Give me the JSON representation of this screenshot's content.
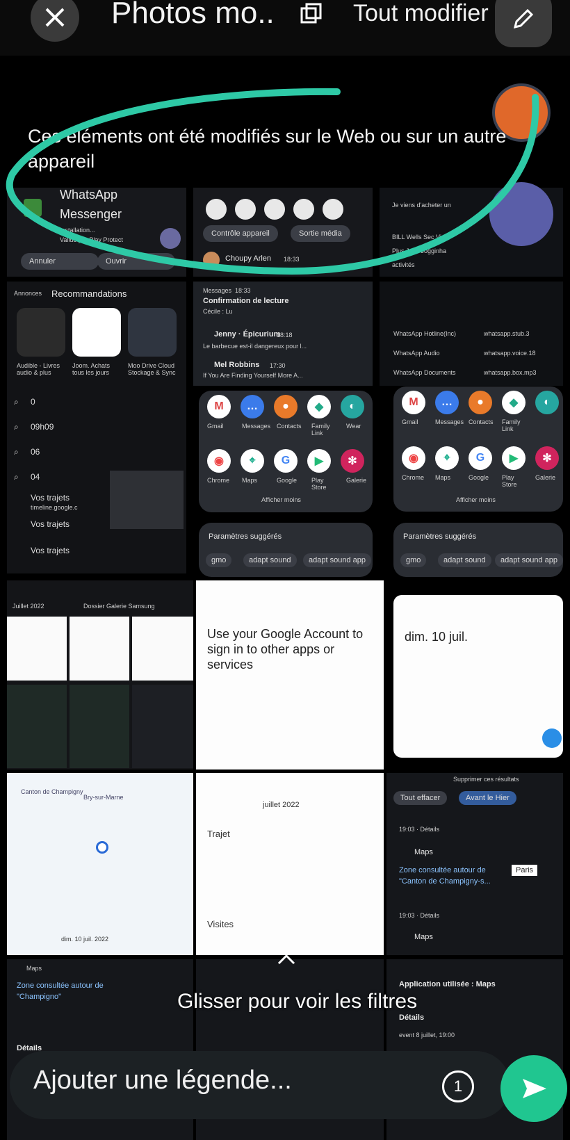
{
  "header": {
    "title": "Photos mo..",
    "edit_all": "Tout modifier",
    "notice": "Ces éléments ont été modifiés sur le Web ou sur un autre appareil"
  },
  "tile1": {
    "app_name_1": "WhatsApp",
    "app_name_2": "Messenger",
    "status": "Installation...",
    "verified": "Validé par Play Protect",
    "btn_left": "Annuler",
    "btn_right": "Ouvrir"
  },
  "tile2": {
    "btn_left": "Contrôle appareil",
    "btn_right": "Sortie média",
    "contact": "Choupy Arlen",
    "time": "18:33"
  },
  "tile3": {
    "line1": "Je viens d'acheter un",
    "line2": "BILL Wells Sec Visit",
    "line3": "Plus Jeux Jogginha",
    "line4": "activités"
  },
  "recs": {
    "header_prefix": "Annonces",
    "header": "Recommandations",
    "apps": [
      {
        "name": "Audible - Livres audio & plus"
      },
      {
        "name": "Joom. Achats tous les jours"
      },
      {
        "name": "Moo Drive Cloud Stockage & Sync"
      }
    ],
    "searches": [
      "0",
      "09h09",
      "06",
      "04"
    ],
    "trips_label": "Vos trajets",
    "trips_link": "timeline.google.c"
  },
  "notifs": {
    "app": "Messages",
    "time1": "18:33",
    "title1": "Confirmation de lecture",
    "sub1": "Cécile : Lu",
    "title2": "Jenny · Épicurium",
    "time2": "18:18",
    "sub2": "Le barbecue est-il dangereux pour l...",
    "title3": "Mel Robbins",
    "time3": "17:30",
    "sub3": "If You Are Finding Yourself More A..."
  },
  "settings_list": {
    "items": [
      "WhatsApp Hotline(Inc)",
      "WhatsApp Audio",
      "WhatsApp Documents"
    ],
    "right_items": [
      "whatsapp.stub.3",
      "whatsapp.voice.18",
      "whatsapp.box.mp3"
    ]
  },
  "apps_grid": {
    "row1": [
      "Gmail",
      "Messages",
      "Contacts",
      "Family Link",
      "Wear"
    ],
    "row2": [
      "Chrome",
      "Maps",
      "Google",
      "Play Store",
      "Galerie"
    ],
    "show_less": "Afficher moins"
  },
  "suggested": {
    "title": "Paramètres suggérés",
    "chips": [
      "gmo",
      "adapt sound",
      "adapt sound app"
    ]
  },
  "gallery": {
    "date": "Juillet 2022",
    "folder": "Dossier Galerie Samsung"
  },
  "google_doc": {
    "title": "Use your Google Account to sign in to other apps or services"
  },
  "calendar": {
    "date": "dim. 10 juil."
  },
  "map": {
    "place1": "Canton de Champigny",
    "place2": "Bry-sur-Marne",
    "date": "dim. 10 juil. 2022"
  },
  "timeline": {
    "month": "juillet 2022",
    "trip": "Trajet",
    "visits": "Visites"
  },
  "history": {
    "delete": "Supprimer ces résultats",
    "clear": "Tout effacer",
    "before": "Avant le Hier",
    "time1": "19:03 · Détails",
    "maps": "Maps",
    "zone": "Zone consultée autour de \"Canton de Champigny-s...",
    "time2": "19:03 · Détails",
    "maps2": "Maps",
    "paris": "Paris"
  },
  "bottom_row": {
    "maps": "Maps",
    "zone": "Zone consultée autour de \"Champigno\"",
    "details": "Détails",
    "app_used": "Application utilisée : Maps",
    "details2": "Détails",
    "event": "event 8 juillet, 19:00"
  },
  "overlay": {
    "swipe": "Glisser pour voir les filtres",
    "caption_placeholder": "Ajouter une légende...",
    "timer": "1"
  },
  "colors": {
    "accent": "#20c690",
    "marker": "#2ec9a6"
  }
}
